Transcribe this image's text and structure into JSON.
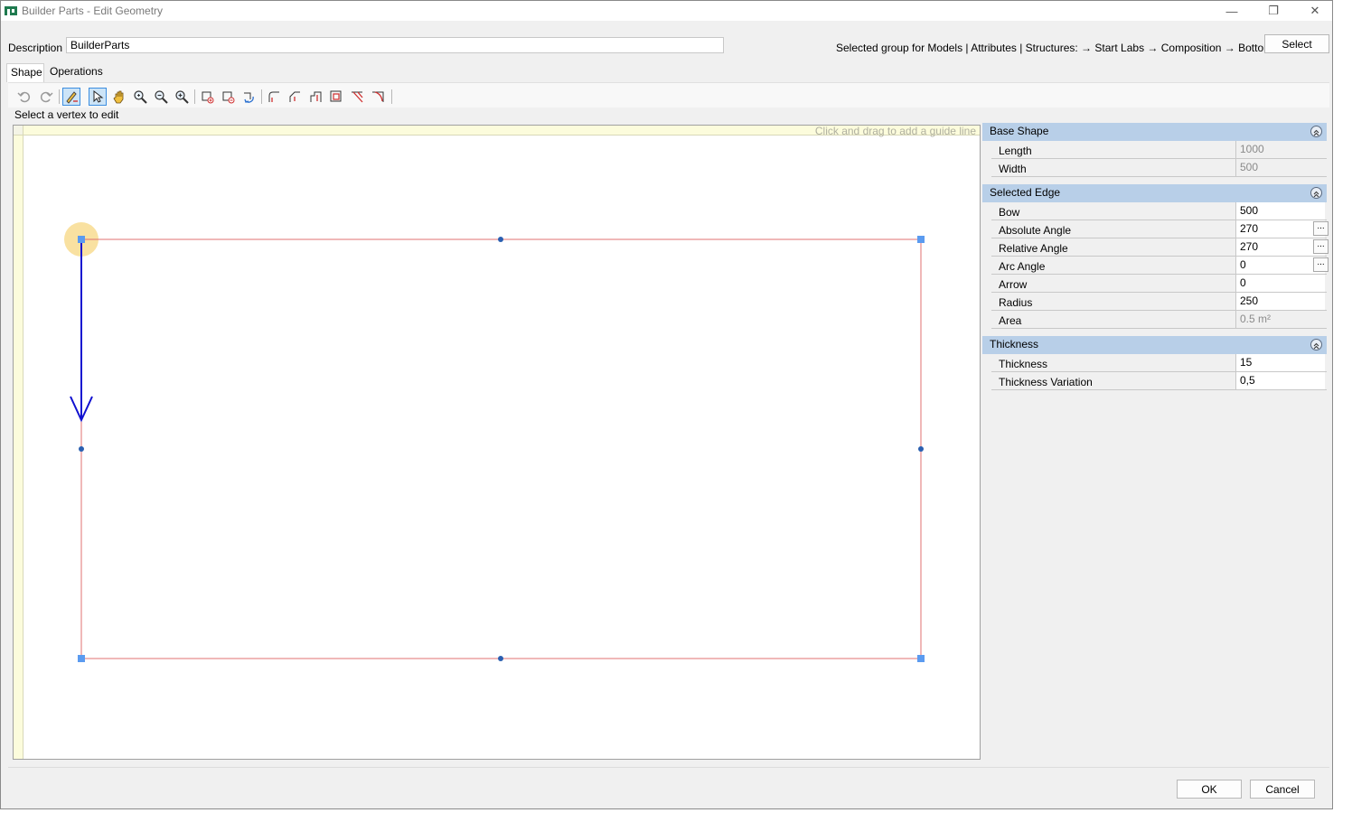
{
  "window": {
    "title": "Builder Parts - Edit Geometry",
    "controls": {
      "minimize": "—",
      "maximize": "❐",
      "close": "✕"
    }
  },
  "description": {
    "label": "Description",
    "value": "BuilderParts"
  },
  "group": {
    "text": "Selected group for Models | Attributes | Structures:  → Start Labs → Composition → Bottoms",
    "select_label": "Select"
  },
  "tabs": [
    {
      "label": "Shape",
      "active": true
    },
    {
      "label": "Operations",
      "active": false
    }
  ],
  "toolbar": {
    "icons": [
      "undo-icon",
      "redo-icon",
      "edit-vertex-icon",
      "select-pointer-icon",
      "pan-hand-icon",
      "zoom-fit-icon",
      "zoom-out-icon",
      "zoom-in-icon",
      "add-vertex-icon",
      "remove-vertex-icon",
      "rotate-icon",
      "corner-round-icon",
      "corner-chamfer-icon",
      "corner-notch-icon",
      "corner-rect-icon",
      "cut-diagonal-icon",
      "cut-arc-icon"
    ]
  },
  "hint": "Select a vertex to edit",
  "canvas": {
    "guide_hint": "Click and drag to add a guide line",
    "colors": {
      "outline": "#e07070",
      "arrow": "#1010d0",
      "handle": "#5b9bf0",
      "midpoint": "#2a5fb0",
      "highlight": "#f8dc90"
    }
  },
  "properties": {
    "base_shape": {
      "title": "Base Shape",
      "rows": [
        {
          "name": "Length",
          "value": "1000"
        },
        {
          "name": "Width",
          "value": "500"
        }
      ]
    },
    "selected_edge": {
      "title": "Selected Edge",
      "rows": [
        {
          "name": "Bow",
          "value": "500"
        },
        {
          "name": "Absolute Angle",
          "value": "270"
        },
        {
          "name": "Relative Angle",
          "value": "270"
        },
        {
          "name": "Arc Angle",
          "value": "0"
        },
        {
          "name": "Arrow",
          "value": "0"
        },
        {
          "name": "Radius",
          "value": "250"
        },
        {
          "name": "Area",
          "value": "0.5 m²"
        }
      ],
      "ellipsis": "..."
    },
    "thickness": {
      "title": "Thickness",
      "rows": [
        {
          "name": "Thickness",
          "value": "15"
        },
        {
          "name": "Thickness Variation",
          "value": "0,5"
        }
      ]
    }
  },
  "buttons": {
    "ok": "OK",
    "cancel": "Cancel"
  }
}
